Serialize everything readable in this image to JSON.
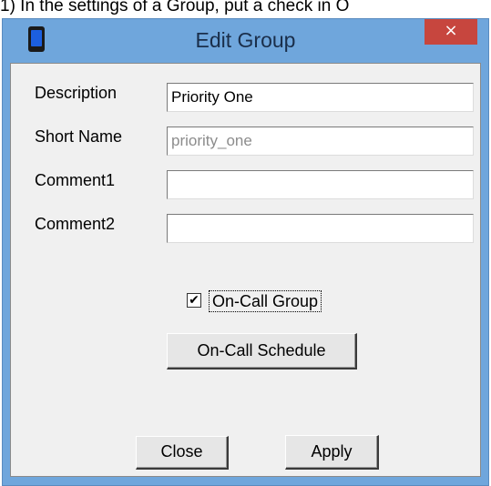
{
  "caption": {
    "text": "1) In the settings of a Group, put a check in O"
  },
  "window": {
    "title": "Edit Group",
    "close_symbol": "×",
    "icon": "device-icon"
  },
  "form": {
    "description_label": "Description",
    "description_value": "Priority One",
    "short_name_label": "Short Name",
    "short_name_value": "priority_one",
    "comment1_label": "Comment1",
    "comment1_value": "",
    "comment2_label": "Comment2",
    "comment2_value": "",
    "on_call_checked": true,
    "on_call_check_mark": "✔",
    "on_call_label": "On-Call Group",
    "on_call_schedule_label": "On-Call Schedule"
  },
  "buttons": {
    "close_label": "Close",
    "apply_label": "Apply"
  },
  "colors": {
    "frame": "#6fa6dc",
    "close_button": "#c7463e",
    "dialog_bg": "#f0f0f0"
  }
}
